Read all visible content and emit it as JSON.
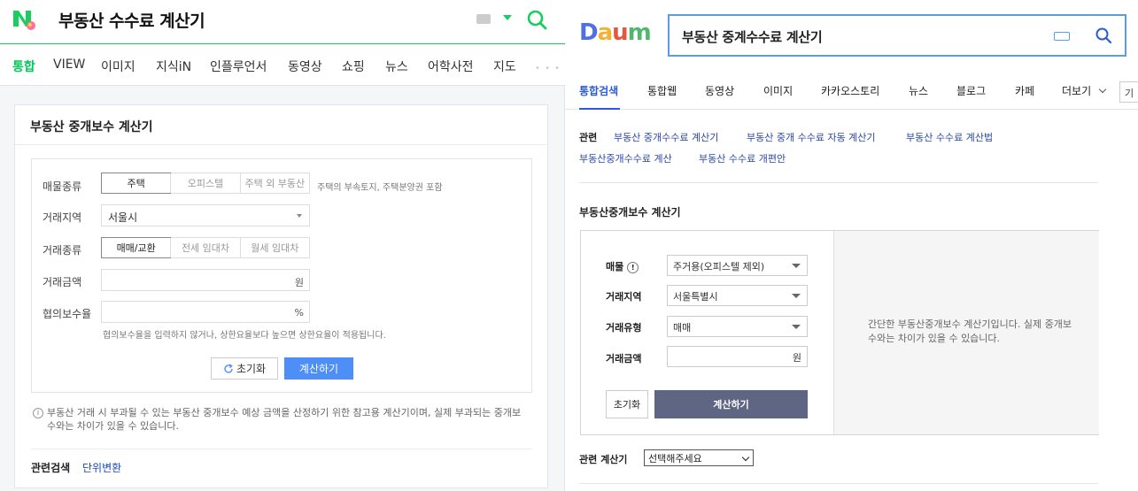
{
  "naver": {
    "query": "부동산 수수료 계산기",
    "tabs": [
      "통합",
      "VIEW",
      "이미지",
      "지식iN",
      "인플루언서",
      "동영상",
      "쇼핑",
      "뉴스",
      "어학사전",
      "지도"
    ],
    "more": "• • •",
    "card_title": "부동산 중개보수 계산기",
    "labels": {
      "type": "매물종류",
      "region": "거래지역",
      "deal": "거래종류",
      "amount": "거래금액",
      "rate": "협의보수율"
    },
    "type_options": [
      "주택",
      "오피스텔",
      "주택 외 부동산"
    ],
    "type_hint": "주택의 부속토지, 주택분양권 포함",
    "region_value": "서울시",
    "deal_options": [
      "매매/교환",
      "전세 임대차",
      "월세 임대차"
    ],
    "amount_unit": "원",
    "rate_unit": "%",
    "rate_hint": "협의보수율을 입력하지 않거나, 상한요율보다 높으면 상한요율이 적용됩니다.",
    "reset_label": "초기화",
    "calc_label": "계산하기",
    "note": "부동산 거래 시 부과될 수 있는 부동산 중개보수 예상 금액을 산정하기 위한 참고용 계산기이며, 실제 부과되는 중개보수와는 차이가 있을 수 있습니다.",
    "related_label": "관련검색",
    "related_link": "단위변환"
  },
  "daum": {
    "logo": "Daum",
    "query": "부동산 중계수수료 계산기",
    "tabs": [
      "통합검색",
      "통합웹",
      "동영상",
      "이미지",
      "카카오스토리",
      "뉴스",
      "블로그",
      "카페",
      "더보기"
    ],
    "edge_tab": "기",
    "related_label": "관련",
    "related_links": [
      "부동산 중개수수료 계산기",
      "부동산 중개 수수료 자동 계산기",
      "부동산 수수료 계산법",
      "부동산중개수수료 계산",
      "부동산 수수료 개편안"
    ],
    "section_title": "부동산중개보수 계산기",
    "labels": {
      "property": "매물",
      "region": "거래지역",
      "deal": "거래유형",
      "amount": "거래금액"
    },
    "property_value": "주거용(오피스텔 제외)",
    "region_value": "서울특별시",
    "deal_value": "매매",
    "amount_unit": "원",
    "reset_label": "초기화",
    "calc_label": "계산하기",
    "description": "간단한 부동산중개보수 계산기입니다. 실제 중개보수와는 차이가 있을 수 있습니다.",
    "related_calc_label": "관련 계산기",
    "related_calc_value": "선택해주세요"
  },
  "colors": {
    "naver_green": "#03c75a",
    "naver_blue": "#4e8ef7",
    "daum_blue": "#2c5bd7",
    "daum_calc": "#5f6683"
  }
}
